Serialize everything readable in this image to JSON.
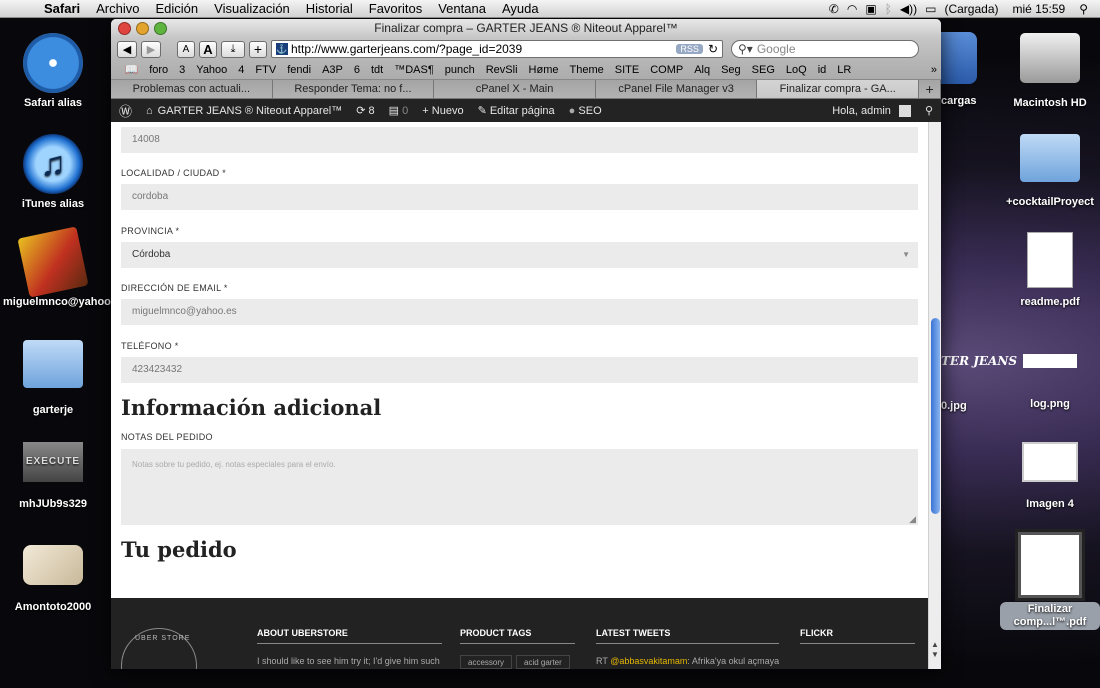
{
  "menubar": {
    "app": "Safari",
    "items": [
      "Archivo",
      "Edición",
      "Visualización",
      "Historial",
      "Favoritos",
      "Ventana",
      "Ayuda"
    ],
    "battery": "(Cargada)",
    "clock": "mié 15:59"
  },
  "desktop_left": [
    {
      "label": "Safari alias"
    },
    {
      "label": "iTunes alias"
    },
    {
      "label": "miguelmnco@yahoo.es"
    },
    {
      "label": "garterje"
    },
    {
      "label": "mhJUb9s329"
    },
    {
      "label": "Amontoto2000"
    }
  ],
  "desktop_right": [
    {
      "label": "Macintosh HD"
    },
    {
      "label": "+cocktailProyect"
    },
    {
      "label": "readme.pdf"
    },
    {
      "label": "log.png"
    },
    {
      "label": "Imagen 4"
    },
    {
      "label": "Finalizar comp...l™.pdf"
    }
  ],
  "desktop_partial": {
    "cargas": "cargas",
    "jpg": "0.jpg",
    "brand": "TER JEANS"
  },
  "browser": {
    "title": "Finalizar compra – GARTER JEANS ® Niteout Apparel™",
    "url": "http://www.garterjeans.com/?page_id=2039",
    "search_placeholder": "Google",
    "rss": "RSS",
    "bookmarks": [
      "foro",
      "3",
      "Yahoo",
      "4",
      "FTV",
      "fendi",
      "A3P",
      "6",
      "tdt",
      "™DAS¶",
      "punch",
      "RevSli",
      "Høme",
      "Theme",
      "SITE",
      "COMP",
      "Alq",
      "Seg",
      "SEG",
      "LoQ",
      "id",
      "LR"
    ],
    "tabs": [
      "Problemas con actuali...",
      "Responder Tema: no f...",
      "cPanel X - Main",
      "cPanel File Manager v3",
      "Finalizar compra - GA..."
    ]
  },
  "adminbar": {
    "site": "GARTER JEANS ® Niteout Apparel™",
    "updates": "8",
    "comments": "0",
    "new": "Nuevo",
    "edit": "Editar página",
    "seo": "SEO",
    "greeting": "Hola, admin"
  },
  "form": {
    "postcode_value": "14008",
    "city_label": "LOCALIDAD / CIUDAD",
    "city_value": "cordoba",
    "province_label": "PROVINCIA",
    "province_value": "Córdoba",
    "email_label": "DIRECCIÓN DE EMAIL",
    "email_value": "miguelmnco@yahoo.es",
    "phone_label": "TELÉFONO",
    "phone_value": "423423432",
    "req_mark": "*",
    "additional_heading": "Información adicional",
    "notes_label": "NOTAS DEL PEDIDO",
    "notes_placeholder": "Notas sobre tu pedido, ej. notas especiales para el envío.",
    "order_heading": "Tu pedido"
  },
  "footer": {
    "about_title": "ABOUT UBERSTORE",
    "about_text": "I should like to see him try it; I'd give him such a",
    "tags_title": "PRODUCT TAGS",
    "tags": [
      "accessory",
      "acid garter"
    ],
    "tweets_title": "LATEST TWEETS",
    "tweet_prefix": "RT",
    "tweet_user": "@abbasvakitamam",
    "tweet_text": ": Afrika'ya okul açmaya",
    "flickr_title": "FLICKR",
    "badge_text": "UBER STORE"
  }
}
